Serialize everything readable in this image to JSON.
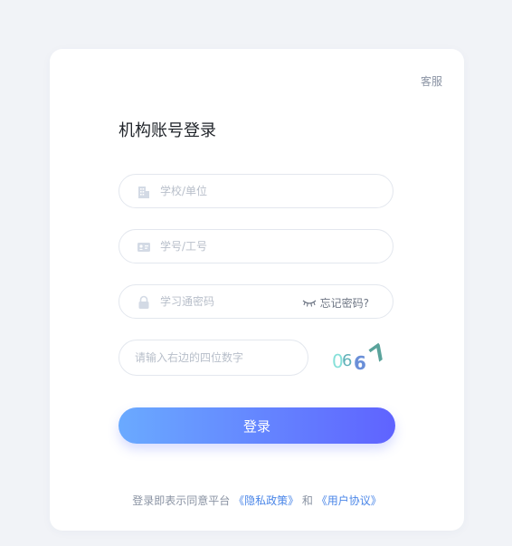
{
  "header": {
    "service_label": "客服",
    "title": "机构账号登录"
  },
  "form": {
    "school": {
      "placeholder": "学校/单位",
      "value": ""
    },
    "account": {
      "placeholder": "学号/工号",
      "value": ""
    },
    "password": {
      "placeholder": "学习通密码",
      "value": ""
    },
    "forgot_label": "忘记密码?",
    "captcha": {
      "placeholder": "请输入右边的四位数字",
      "value": ""
    },
    "captcha_image_text": [
      "0",
      "6",
      "6",
      "7"
    ],
    "submit_label": "登录"
  },
  "agreement": {
    "prefix": "登录即表示同意平台",
    "privacy_link": "《隐私政策》",
    "conjunction": "和",
    "terms_link": "《用户协议》"
  },
  "colors": {
    "background": "#f1f3f7",
    "button_gradient_start": "#6aaaff",
    "button_gradient_end": "#5f63ff",
    "link": "#4a86e8"
  },
  "icons": {
    "school": "building-icon",
    "account": "id-card-icon",
    "password": "lock-icon",
    "forgot": "eye-closed-icon"
  }
}
